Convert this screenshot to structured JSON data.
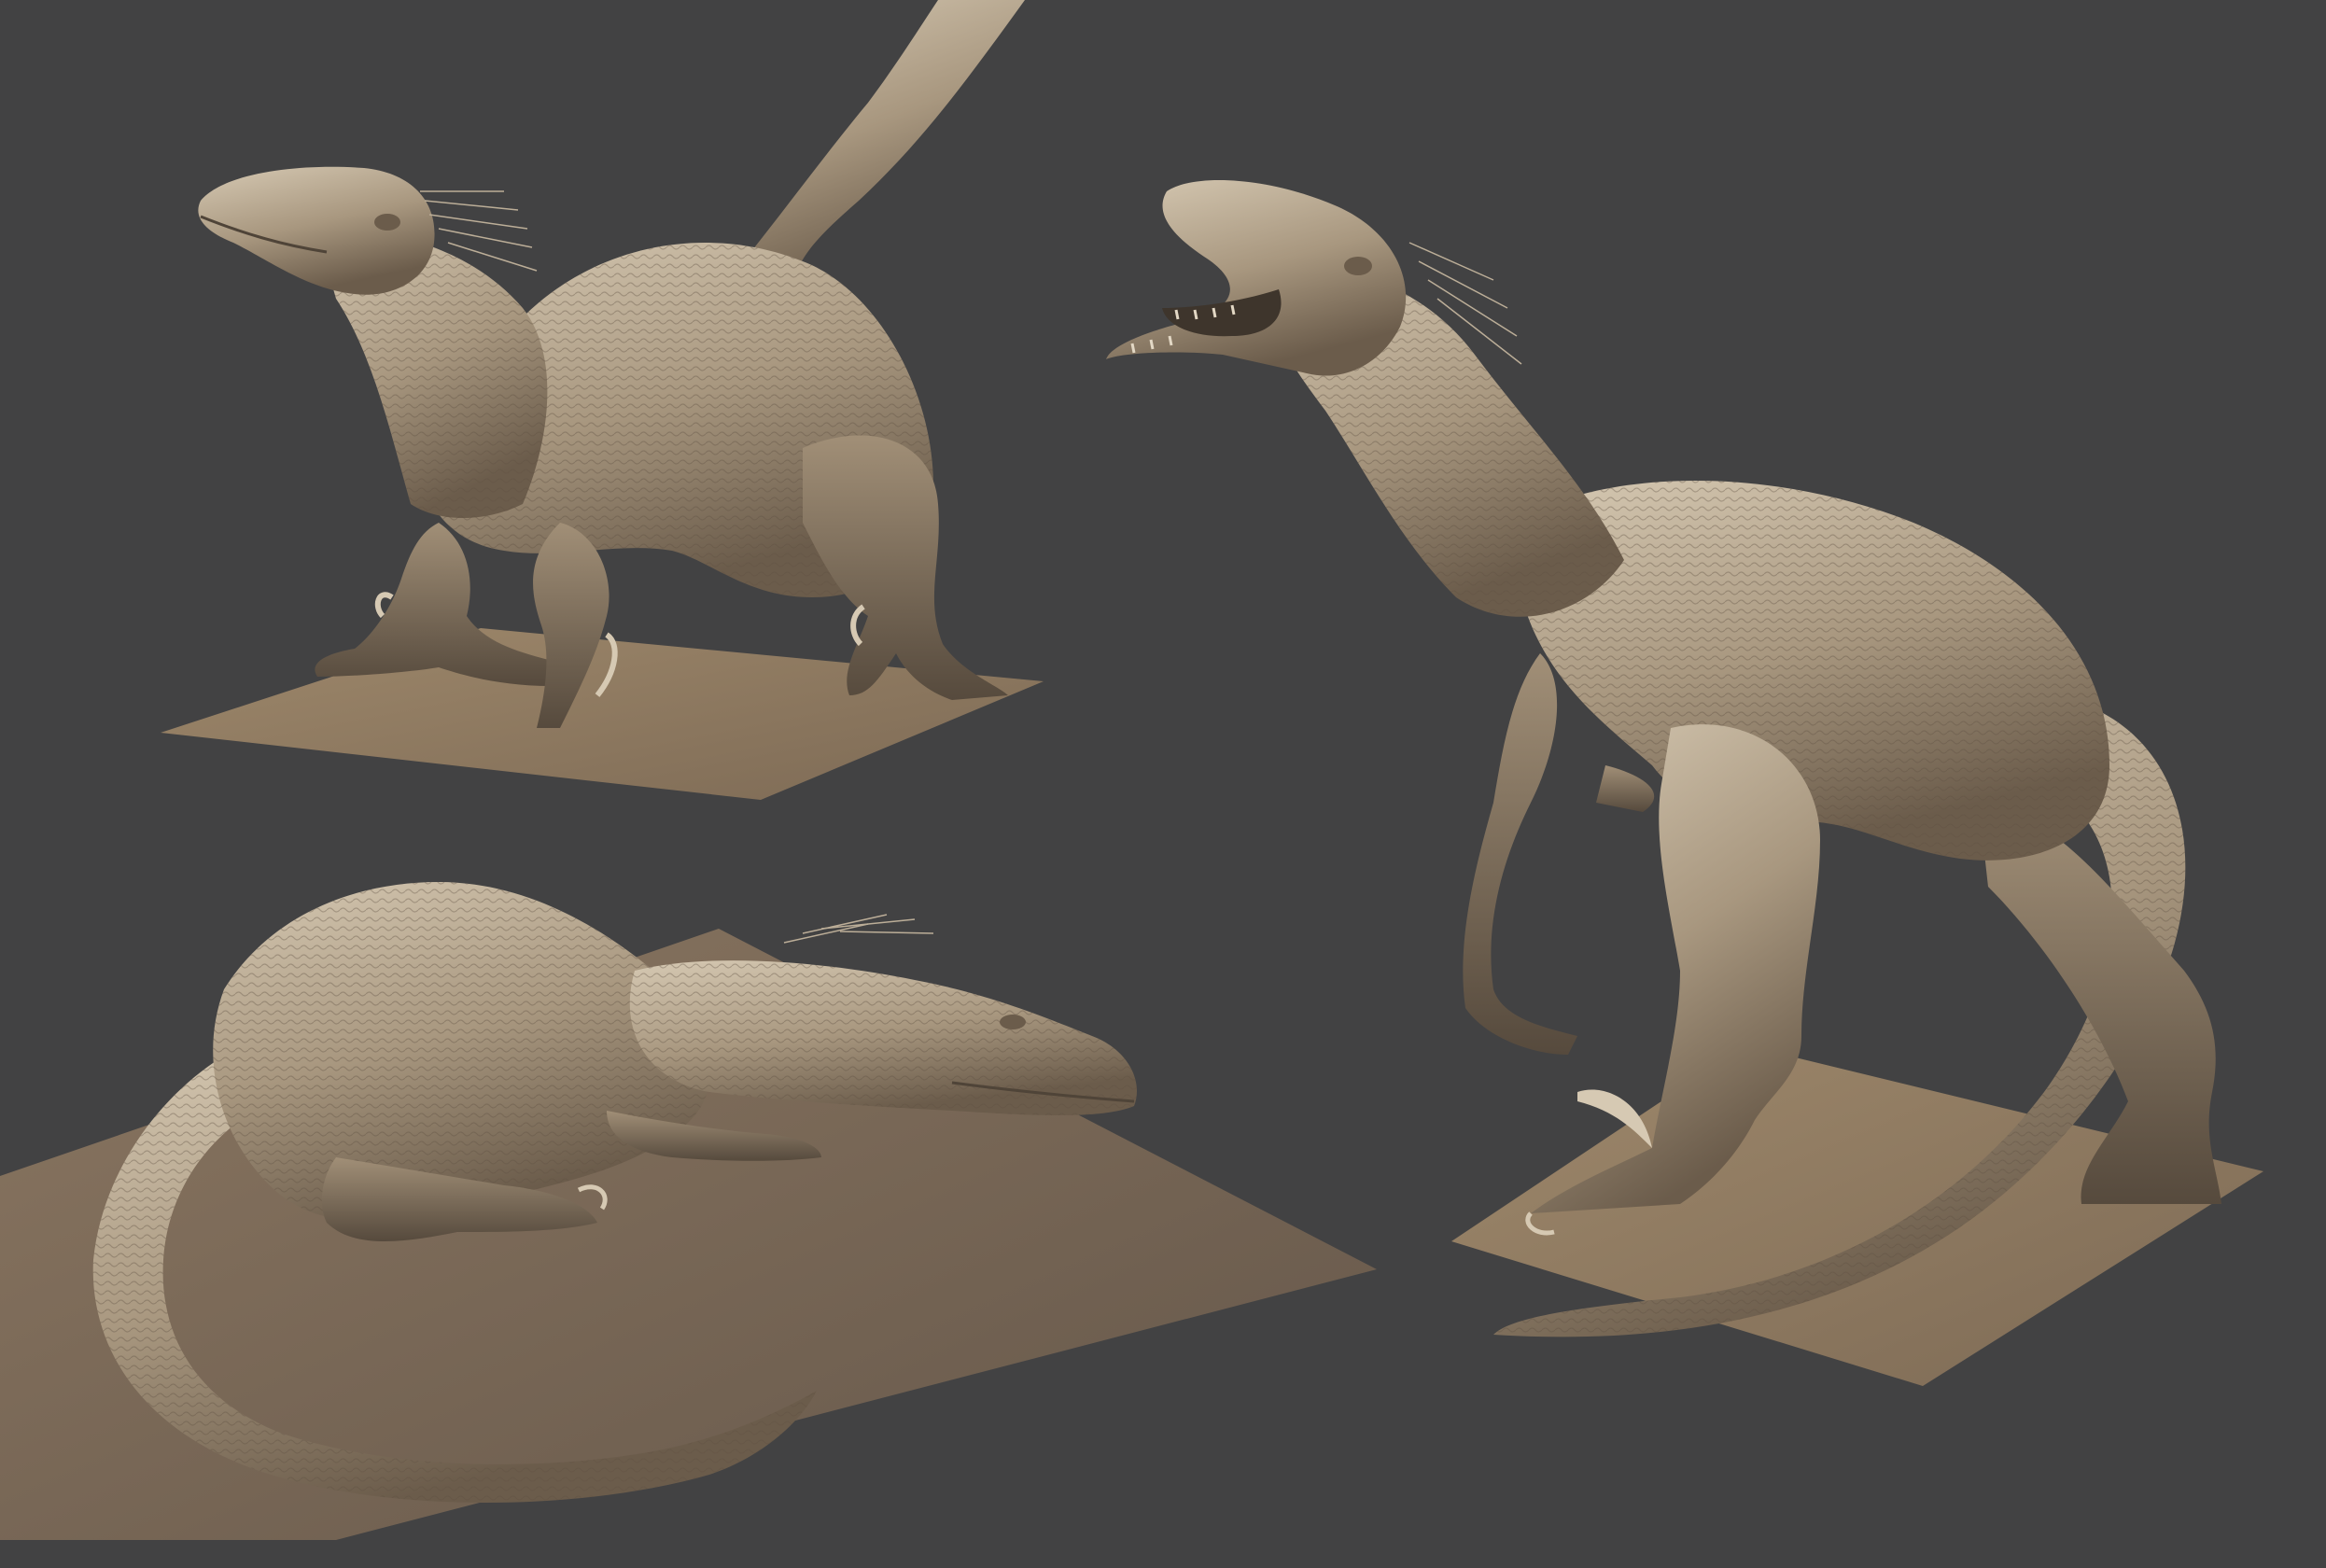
{
  "scene": {
    "description_hidden": "",
    "colors": {
      "background": "#424243",
      "base_top": "#9c8669",
      "base_bottom": "#6f5f4d",
      "clay_light": "#cfc1ab",
      "clay_mid": "#a8977f",
      "clay_dark": "#6b5c4b",
      "clay_shadow": "#4f4438"
    },
    "models": [
      {
        "pose": "crouching",
        "icon": "raptor-crouching-icon"
      },
      {
        "pose": "standing-roaring",
        "icon": "raptor-roaring-icon"
      },
      {
        "pose": "lying-resting",
        "icon": "raptor-resting-icon"
      }
    ]
  }
}
